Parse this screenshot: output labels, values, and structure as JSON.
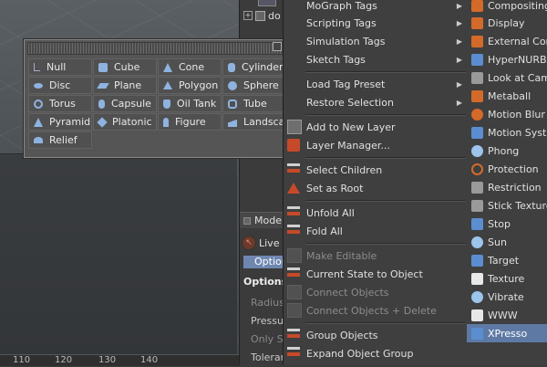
{
  "palette": {
    "items": [
      {
        "label": "Null",
        "icon": "null-icon"
      },
      {
        "label": "Cube",
        "icon": "cube-icon"
      },
      {
        "label": "Cone",
        "icon": "cone-icon"
      },
      {
        "label": "Cylinder",
        "icon": "cylinder-icon"
      },
      {
        "label": "Disc",
        "icon": "disc-icon"
      },
      {
        "label": "Plane",
        "icon": "plane-icon"
      },
      {
        "label": "Polygon",
        "icon": "polygon-icon"
      },
      {
        "label": "Sphere",
        "icon": "sphere-icon"
      },
      {
        "label": "Torus",
        "icon": "torus-icon"
      },
      {
        "label": "Capsule",
        "icon": "capsule-icon"
      },
      {
        "label": "Oil Tank",
        "icon": "oil-tank-icon"
      },
      {
        "label": "Tube",
        "icon": "tube-icon"
      },
      {
        "label": "Pyramid",
        "icon": "pyramid-icon"
      },
      {
        "label": "Platonic",
        "icon": "platonic-icon"
      },
      {
        "label": "Figure",
        "icon": "figure-icon"
      },
      {
        "label": "Landscape",
        "icon": "landscape-icon"
      },
      {
        "label": "Relief",
        "icon": "relief-icon"
      }
    ]
  },
  "object_manager": {
    "tree_item": "do"
  },
  "attributes": {
    "tab": "Mode",
    "live": "Live",
    "options_tab": "Option",
    "options_heading": "Options",
    "rows": [
      "Radius",
      "Pressure",
      "Only Se",
      "Toleran"
    ]
  },
  "ruler": {
    "ticks": [
      "110",
      "120",
      "130",
      "140"
    ]
  },
  "context_menu": {
    "items": [
      {
        "label": "MoGraph Tags",
        "submenu": true
      },
      {
        "label": "Scripting Tags",
        "submenu": true
      },
      {
        "label": "Simulation Tags",
        "submenu": true
      },
      {
        "label": "Sketch Tags",
        "submenu": true
      },
      {
        "label": "Load Tag Preset",
        "submenu": true
      },
      {
        "label": "Restore Selection",
        "submenu": true
      },
      {
        "label": "Add to New Layer"
      },
      {
        "label": "Layer Manager..."
      },
      {
        "label": "Select Children"
      },
      {
        "label": "Set as Root"
      },
      {
        "label": "Unfold All"
      },
      {
        "label": "Fold All"
      },
      {
        "label": "Make Editable",
        "disabled": true
      },
      {
        "label": "Current State to Object"
      },
      {
        "label": "Connect Objects",
        "disabled": true
      },
      {
        "label": "Connect Objects + Delete",
        "disabled": true
      },
      {
        "label": "Group Objects"
      },
      {
        "label": "Expand Object Group"
      }
    ]
  },
  "tags_menu": {
    "items": [
      {
        "label": "Compositing",
        "icon": "compositing-icon"
      },
      {
        "label": "Display",
        "icon": "display-icon"
      },
      {
        "label": "External Com",
        "icon": "external-compositing-icon"
      },
      {
        "label": "HyperNURBS",
        "icon": "hypernurbs-icon"
      },
      {
        "label": "Look at Came",
        "icon": "look-at-camera-icon"
      },
      {
        "label": "Metaball",
        "icon": "metaball-icon"
      },
      {
        "label": "Motion Blur",
        "icon": "motion-blur-icon"
      },
      {
        "label": "Motion Syster",
        "icon": "motion-system-icon"
      },
      {
        "label": "Phong",
        "icon": "phong-icon"
      },
      {
        "label": "Protection",
        "icon": "protection-icon"
      },
      {
        "label": "Restriction",
        "icon": "restriction-icon"
      },
      {
        "label": "Stick Texture",
        "icon": "stick-texture-icon"
      },
      {
        "label": "Stop",
        "icon": "stop-icon"
      },
      {
        "label": "Sun",
        "icon": "sun-icon"
      },
      {
        "label": "Target",
        "icon": "target-icon"
      },
      {
        "label": "Texture",
        "icon": "texture-icon"
      },
      {
        "label": "Vibrate",
        "icon": "vibrate-icon"
      },
      {
        "label": "WWW",
        "icon": "www-icon"
      },
      {
        "label": "XPresso",
        "icon": "xpresso-icon",
        "selected": true
      }
    ]
  }
}
